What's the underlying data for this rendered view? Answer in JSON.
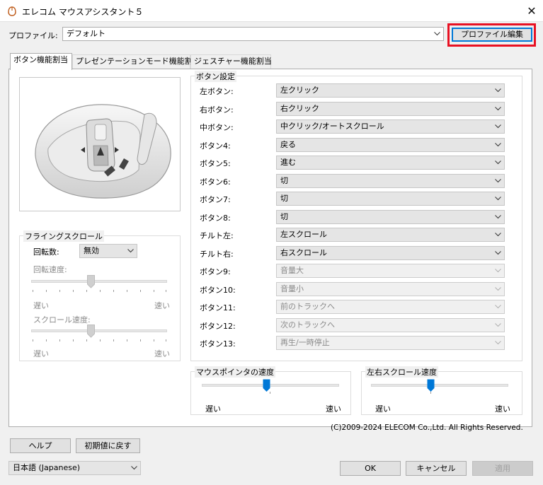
{
  "window": {
    "title": "エレコム マウスアシスタント５"
  },
  "profile": {
    "label": "プロファイル:",
    "value": "デフォルト",
    "edit_button": "プロファイル編集"
  },
  "tabs": [
    "ボタン機能割当",
    "プレゼンテーションモード機能割当",
    "ジェスチャー機能割当"
  ],
  "button_settings": {
    "title": "ボタン設定",
    "rows": [
      {
        "label": "左ボタン:",
        "value": "左クリック",
        "enabled": true
      },
      {
        "label": "右ボタン:",
        "value": "右クリック",
        "enabled": true
      },
      {
        "label": "中ボタン:",
        "value": "中クリック/オートスクロール",
        "enabled": true
      },
      {
        "label": "ボタン4:",
        "value": "戻る",
        "enabled": true
      },
      {
        "label": "ボタン5:",
        "value": "進む",
        "enabled": true
      },
      {
        "label": "ボタン6:",
        "value": "切",
        "enabled": true
      },
      {
        "label": "ボタン7:",
        "value": "切",
        "enabled": true
      },
      {
        "label": "ボタン8:",
        "value": "切",
        "enabled": true
      },
      {
        "label": "チルト左:",
        "value": "左スクロール",
        "enabled": true
      },
      {
        "label": "チルト右:",
        "value": "右スクロール",
        "enabled": true
      },
      {
        "label": "ボタン9:",
        "value": "音量大",
        "enabled": false
      },
      {
        "label": "ボタン10:",
        "value": "音量小",
        "enabled": false
      },
      {
        "label": "ボタン11:",
        "value": "前のトラックへ",
        "enabled": false
      },
      {
        "label": "ボタン12:",
        "value": "次のトラックへ",
        "enabled": false
      },
      {
        "label": "ボタン13:",
        "value": "再生/一時停止",
        "enabled": false
      }
    ]
  },
  "flying_scroll": {
    "title": "フライングスクロール",
    "rotation_label": "回転数:",
    "rotation_value": "無効",
    "rotation_speed_label": "回転速度:",
    "rotation_speed_slow": "遅い",
    "rotation_speed_fast": "速い",
    "rotation_speed_level": 0.5,
    "scroll_speed_label": "スクロール速度:",
    "scroll_speed_slow": "遅い",
    "scroll_speed_fast": "速い",
    "scroll_speed_level": 0.5
  },
  "pointer_speed": {
    "title": "マウスポインタの速度",
    "slow": "遅い",
    "fast": "速い",
    "level": 0.5
  },
  "lr_scroll_speed": {
    "title": "左右スクロール速度",
    "slow": "遅い",
    "fast": "速い",
    "level": 0.5
  },
  "copyright": "(C)2009-2024 ELECOM Co.,Ltd. All Rights Reserved.",
  "footer": {
    "help": "ヘルプ",
    "reset": "初期値に戻す",
    "language": "日本語 (Japanese)",
    "ok": "OK",
    "cancel": "キャンセル",
    "apply": "適用"
  },
  "colors": {
    "accent_blue": "#0078d7",
    "highlight_red": "#e81123"
  }
}
